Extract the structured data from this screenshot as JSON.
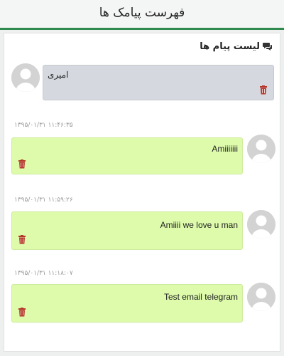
{
  "header": {
    "title": "فهرست پیامک ها"
  },
  "panel": {
    "heading": "لیست پیام ها",
    "heading_icon": "comments-icon"
  },
  "messages": [
    {
      "direction": "incoming",
      "text": "امیری",
      "timestamp": ""
    },
    {
      "direction": "outgoing",
      "text": "Amiiiiiii",
      "timestamp": "۱۳۹۵/۰۱/۳۱ ۱۱:۴۶:۳۵"
    },
    {
      "direction": "outgoing",
      "text": "Amiiii we love u man",
      "timestamp": "۱۳۹۵/۰۱/۳۱ ۱۱:۵۹:۲۶"
    },
    {
      "direction": "outgoing",
      "text": "Test email telegram",
      "timestamp": "۱۳۹۵/۰۱/۳۱ ۱۱:۱۸:۰۷"
    }
  ],
  "colors": {
    "accent_bar": "#2f8a4e",
    "incoming_bubble": "#d5d9df",
    "outgoing_bubble": "#ddfbab",
    "trash_icon": "#b5352a"
  }
}
